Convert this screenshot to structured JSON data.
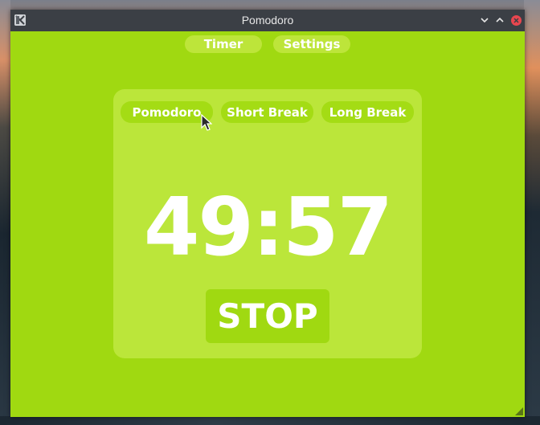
{
  "window": {
    "title": "Pomodoro",
    "accent": "#a0d911",
    "titlebar_color": "#3b3f45",
    "close_color": "#e8464f"
  },
  "nav": {
    "tabs": [
      {
        "label": "Timer"
      },
      {
        "label": "Settings"
      }
    ]
  },
  "modes": [
    {
      "label": "Pomodoro",
      "selected": true
    },
    {
      "label": "Short Break"
    },
    {
      "label": "Long Break"
    }
  ],
  "timer": {
    "time": "49:57",
    "action_label": "STOP"
  },
  "icons": {
    "app": "app-icon",
    "minimize": "chevron-down-icon",
    "maximize": "chevron-up-icon",
    "close": "close-icon",
    "cursor": "mouse-pointer-icon",
    "resize": "resize-grip-icon"
  }
}
